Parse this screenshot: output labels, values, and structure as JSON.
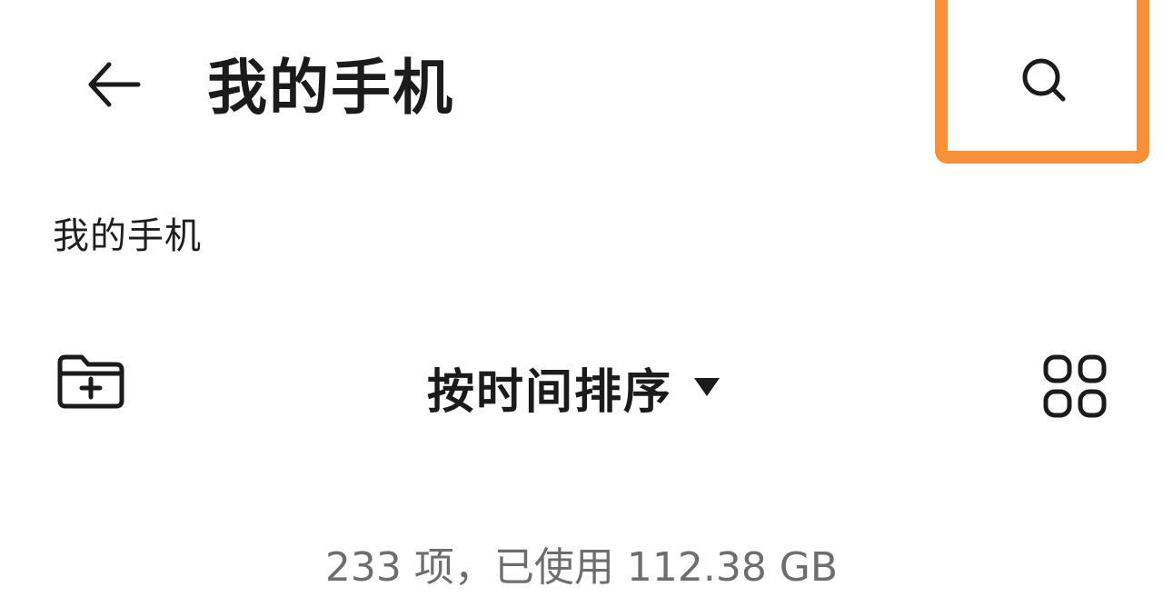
{
  "header": {
    "title": "我的手机",
    "back_icon": "arrow-left-icon",
    "search_icon": "search-icon",
    "highlight_color": "#f79038"
  },
  "breadcrumb": {
    "path": "我的手机"
  },
  "toolbar": {
    "new_folder_icon": "folder-add-icon",
    "sort_label": "按时间排序",
    "sort_caret_icon": "caret-down-icon",
    "view_icon": "grid-view-icon"
  },
  "storage": {
    "summary": "233 项，已使用 112.38 GB"
  },
  "colors": {
    "text_primary": "#1b1b1b",
    "text_secondary": "#6e6e6e",
    "background": "#ffffff"
  }
}
